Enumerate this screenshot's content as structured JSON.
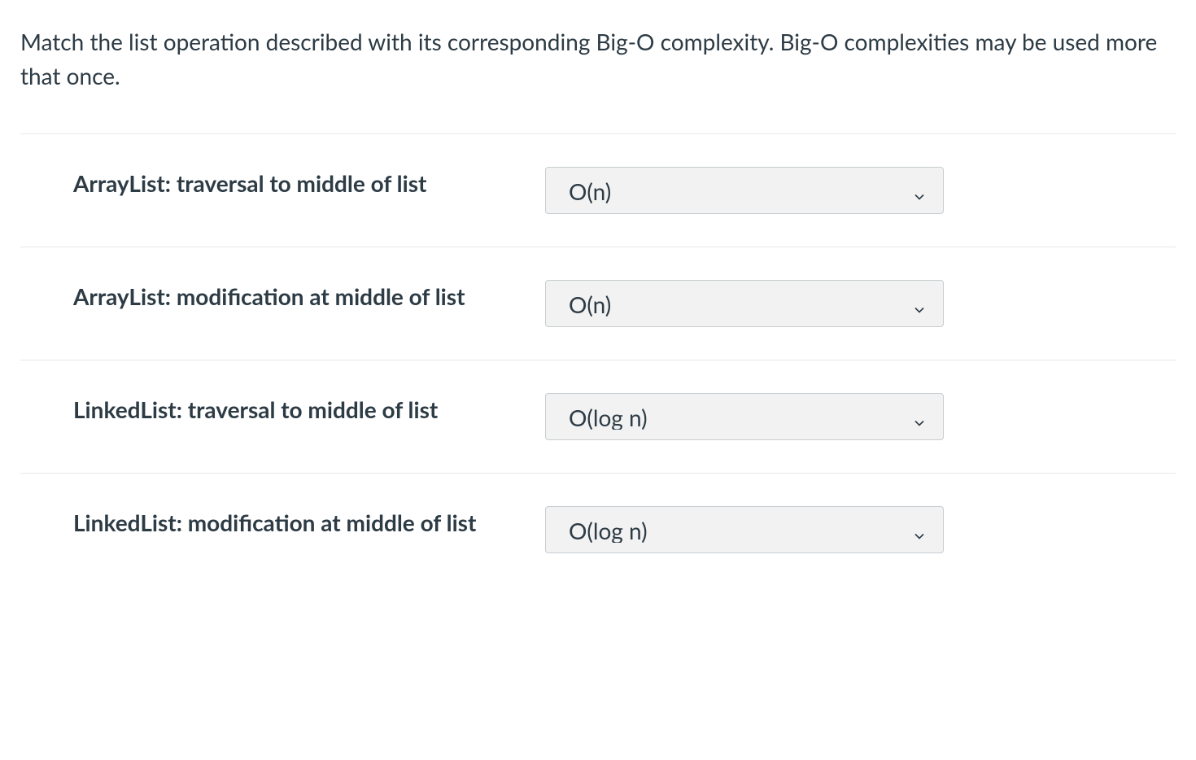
{
  "question": {
    "prompt": "Match the list operation described with its corresponding Big-O complexity. Big-O complexities may be used more that once."
  },
  "matches": [
    {
      "label": "ArrayList: traversal to middle of list",
      "selected": "O(n)"
    },
    {
      "label": "ArrayList: modification at middle of list",
      "selected": "O(n)"
    },
    {
      "label": "LinkedList: traversal to middle of list",
      "selected": "O(log n)"
    },
    {
      "label": "LinkedList: modification at middle of list",
      "selected": "O(log n)"
    }
  ]
}
